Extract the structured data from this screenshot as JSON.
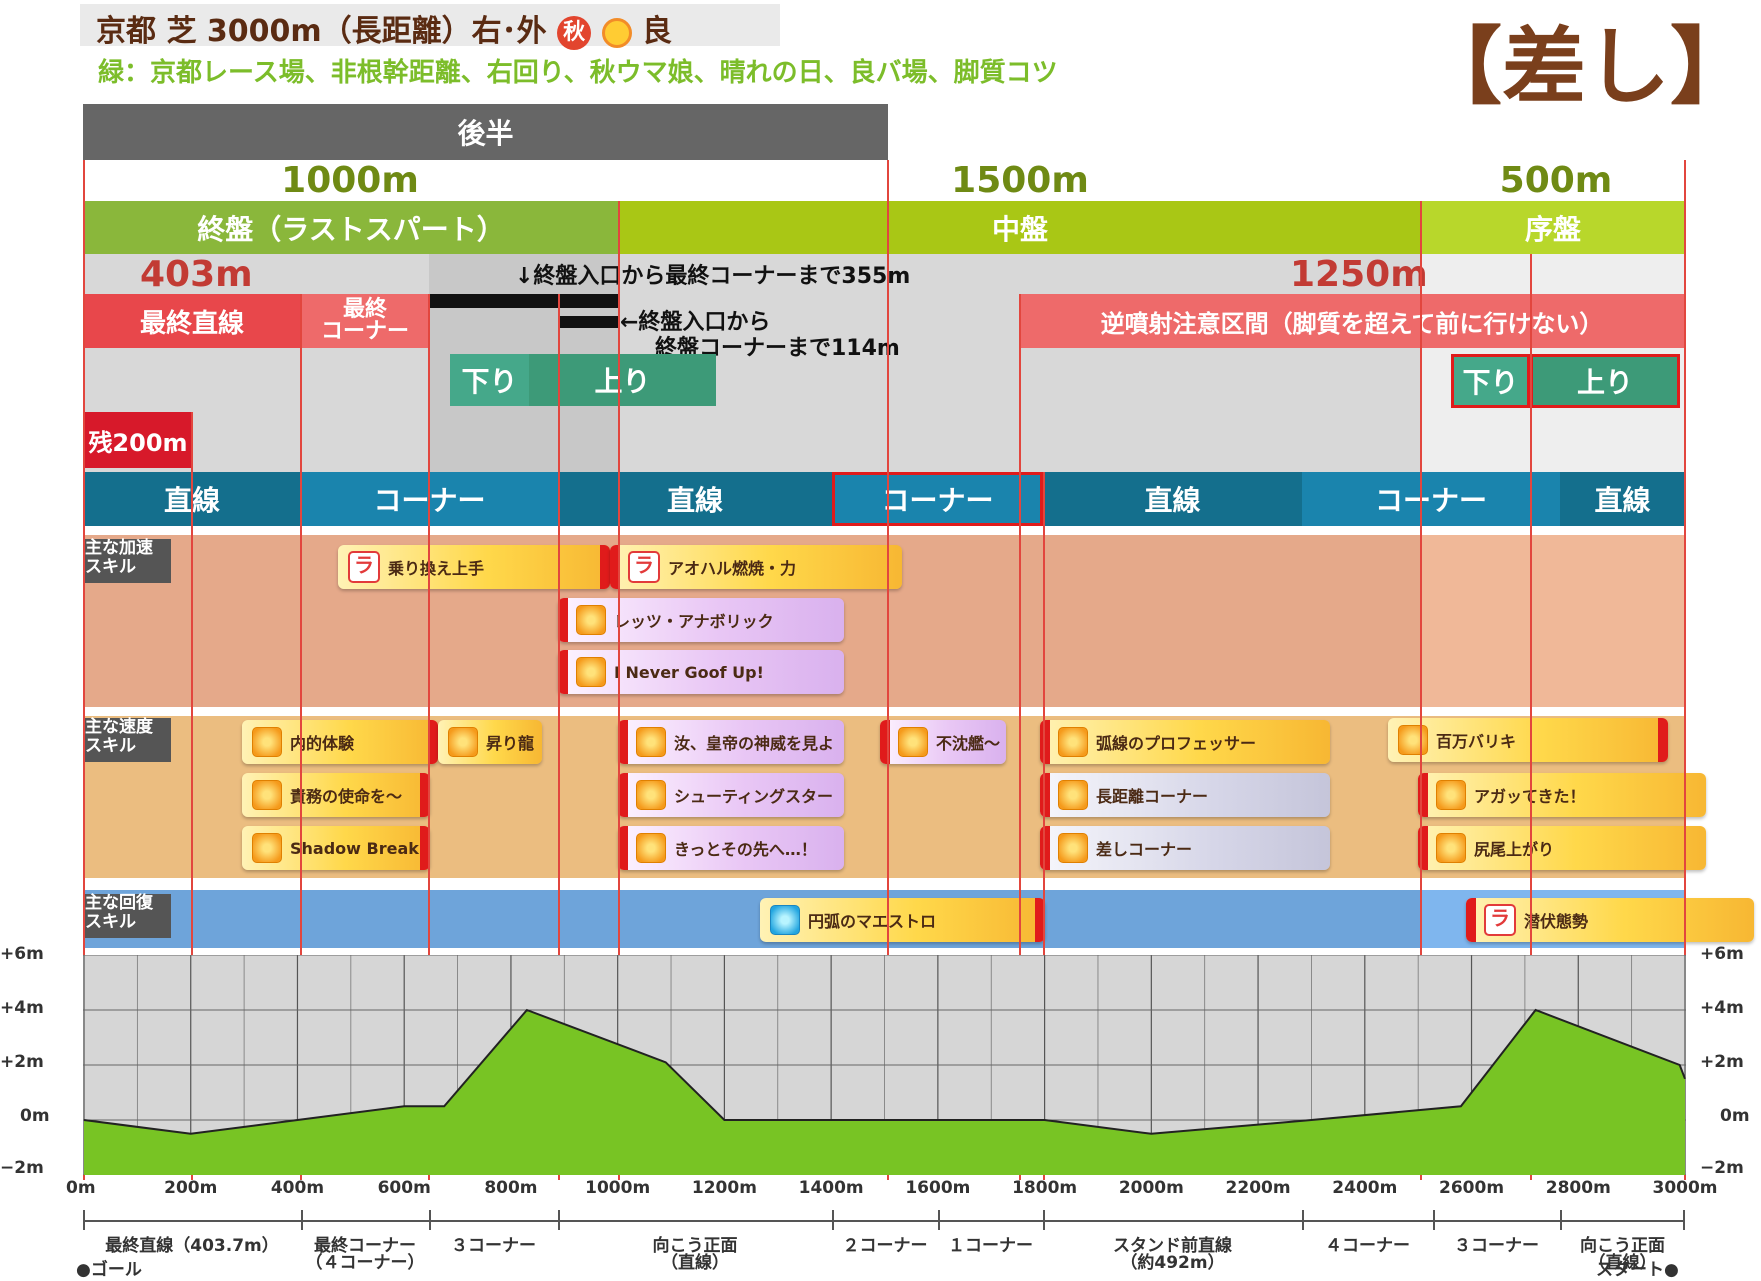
{
  "header": {
    "title": "京都 芝 3000m（長距離）右･外",
    "season": "秋",
    "condition": "良",
    "subtitle": "緑：京都レース場、非根幹距離、右回り、秋ウマ娘、晴れの日、良バ場、脚質コツ",
    "style": "【差し】"
  },
  "colors": {
    "phase_late": "#8ab73b",
    "phase_mid": "#a9c715",
    "phase_early": "#b8d72b",
    "terrain": "#78c424",
    "red": "#e2463e"
  },
  "half_label": "後半",
  "distances": {
    "d1000": "1000m",
    "d1500": "1500m",
    "d500": "500m",
    "d403": "403m",
    "d1250": "1250m"
  },
  "phases": {
    "late": "終盤（ラストスパート）",
    "mid": "中盤",
    "early": "序盤"
  },
  "notes": {
    "final_straight": "最終直線",
    "final_corner": "最終\nコーナー",
    "note_355": "↓終盤入口から最終コーナーまで355m",
    "note_114_l1": "←終盤入口から",
    "note_114_l2": "終盤コーナーまで114m",
    "reverse_zone": "逆噴射注意区間（脚質を超えて前に行けない）",
    "down": "下り",
    "up": "上り",
    "remaining": "残200m"
  },
  "track": [
    "直線",
    "コーナー",
    "直線",
    "コーナー",
    "直線",
    "コーナー",
    "直線"
  ],
  "sections": {
    "accel": "主な加速\nスキル",
    "speed": "主な速度\nスキル",
    "recovery": "主な回復\nスキル"
  },
  "skills": {
    "accel": [
      "乗り換え上手",
      "アオハル燃焼・力",
      "レッツ・アナボリック",
      "I Never Goof Up!"
    ],
    "speed": [
      "内的体験",
      "昇り龍",
      "汝、皇帝の神威を見よ",
      "不沈艦～",
      "弧線のプロフェッサー",
      "百万バリキ",
      "責務の使命を～",
      "シューティングスター",
      "長距離コーナー",
      "アガッてきた！",
      "Shadow Break",
      "きっとその先へ…！",
      "差しコーナー",
      "尻尾上がり"
    ],
    "recovery": [
      "円弧のマエストロ",
      "潜伏態勢"
    ]
  },
  "y_axis": [
    "+6m",
    "+4m",
    "+2m",
    "0m",
    "−2m"
  ],
  "x_axis": [
    "0m",
    "200m",
    "400m",
    "600m",
    "800m",
    "1000m",
    "1200m",
    "1400m",
    "1600m",
    "1800m",
    "2000m",
    "2200m",
    "2400m",
    "2600m",
    "2800m",
    "3000m"
  ],
  "course_segments": [
    "最終直線（403.7m）",
    "最終コーナー\n（４コーナー）",
    "３コーナー",
    "向こう正面\n（直線）",
    "２コーナー",
    "１コーナー",
    "スタンド前直線\n（約492m）",
    "４コーナー",
    "３コーナー",
    "向こう正面\n（直線）"
  ],
  "goal": "●ゴール",
  "start": "スタート●",
  "elevation": {
    "unit": "m",
    "points": [
      [
        0,
        0
      ],
      [
        200,
        -0.5
      ],
      [
        400,
        0
      ],
      [
        600,
        0.5
      ],
      [
        675,
        0.5
      ],
      [
        830,
        4
      ],
      [
        1090,
        2.1
      ],
      [
        1200,
        0
      ],
      [
        1800,
        0
      ],
      [
        2000,
        -0.5
      ],
      [
        2300,
        0
      ],
      [
        2580,
        0.5
      ],
      [
        2720,
        4
      ],
      [
        2990,
        2
      ],
      [
        3000,
        1.5
      ]
    ]
  }
}
